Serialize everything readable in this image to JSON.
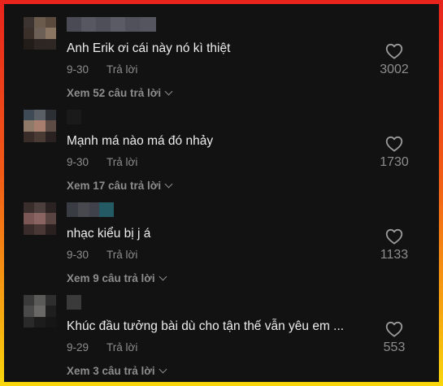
{
  "labels": {
    "reply": "Trả lời"
  },
  "comments": [
    {
      "text": "Anh Erik ơi cái này nó kì thiệt",
      "date": "9-30",
      "likes": "3002",
      "view_replies": "Xem 52 câu trả lời",
      "avatar_colors": [
        "#3b3431",
        "#6b5b4c",
        "#5a4a3d",
        "#3a2f29",
        "#6b5f56",
        "#8a7563",
        "#231d1a",
        "#2e2622",
        "#2f2724"
      ],
      "name_colors": [
        "#4a4a55",
        "#575762",
        "#4f4f5a",
        "#5b5b66",
        "#51515c",
        "#55555f"
      ]
    },
    {
      "text": "Mạnh má nào má đó nhảy",
      "date": "9-30",
      "likes": "1730",
      "view_replies": "Xem 17 câu trả lời",
      "avatar_colors": [
        "#3e4a55",
        "#5a5f66",
        "#2c2f33",
        "#8f7a6a",
        "#a87f6f",
        "#5b4b44",
        "#3a2d29",
        "#4a3a34",
        "#2a2221"
      ],
      "name_colors": [
        "#1a1a1a"
      ]
    },
    {
      "text": "nhạc kiểu bị j á",
      "date": "9-30",
      "likes": "1133",
      "view_replies": "Xem 9 câu trả lời",
      "avatar_colors": [
        "#3a2e2c",
        "#4d3f3d",
        "#2b2322",
        "#7a5654",
        "#8a6461",
        "#5a4442",
        "#3a2c2a",
        "#4a3836",
        "#2a201f"
      ],
      "name_colors": [
        "#3a3c43",
        "#47494f",
        "#3f424a",
        "#245a63"
      ]
    },
    {
      "text": "Khúc đầu tưởng bài dù cho tận thế vẫn yêu em ...",
      "date": "9-29",
      "likes": "553",
      "view_replies": "Xem 3 câu trả lời",
      "avatar_colors": [
        "#3a3a3a",
        "#5a5a58",
        "#2e2e2e",
        "#4a4a4a",
        "#6a6866",
        "#1e1e1e",
        "#2a2a2a",
        "#1c1c1c",
        "#161616"
      ],
      "name_colors": [
        "#3a3a3a"
      ]
    }
  ]
}
